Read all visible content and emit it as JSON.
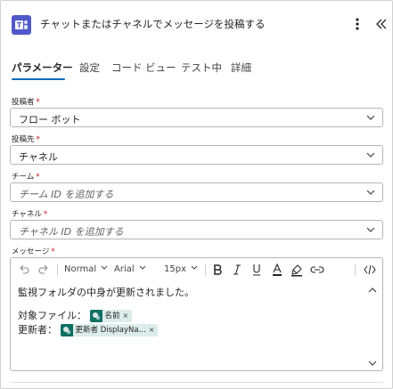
{
  "header": {
    "title": "チャットまたはチャネルでメッセージを投稿する",
    "more_label": "⋮",
    "collapse_label": "«"
  },
  "tabs": [
    {
      "label": "パラメーター",
      "active": true
    },
    {
      "label": "設定",
      "active": false
    },
    {
      "label": "コード ビュー",
      "active": false
    },
    {
      "label": "テスト中",
      "active": false
    },
    {
      "label": "詳細",
      "active": false
    }
  ],
  "fields": {
    "post_as": {
      "label": "投稿者",
      "value": "フロー ボット"
    },
    "post_in": {
      "label": "投稿先",
      "value": "チャネル"
    },
    "team": {
      "label": "チーム",
      "placeholder": "チーム ID を追加する"
    },
    "channel": {
      "label": "チャネル",
      "placeholder": "チャネル ID を追加する"
    },
    "message": {
      "label": "メッセージ"
    },
    "required_mark": "*"
  },
  "toolbar": {
    "font_style": "Normal",
    "font_family": "Arial",
    "font_size": "15px"
  },
  "message": {
    "line1": "監視フォルダの中身が更新されました。",
    "line2_prefix": "対象ファイル：",
    "token1": "名前",
    "line3_prefix": "更新者：",
    "token2": "更新者 DisplayNa...",
    "token_remove": "×"
  },
  "colors": {
    "accent": "#0f6cbd",
    "app_icon": "#5059c9",
    "token_icon": "#0f6f63",
    "token_bg": "#dcecea",
    "required": "#c50f1f"
  }
}
